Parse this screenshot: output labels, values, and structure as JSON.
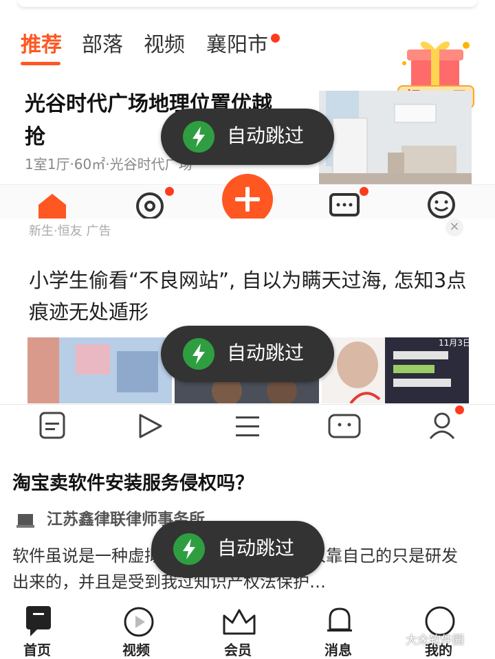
{
  "panel1": {
    "tabs": [
      "推荐",
      "部落",
      "视频",
      "襄阳市"
    ],
    "gift_label": "领380元",
    "listing_title": "光谷时代广场地理位置优越抢",
    "listing_meta": "1室1厅·60㎡·光谷时代广场"
  },
  "panel2": {
    "source": "新生·恒友 广告",
    "close": "×",
    "article_title": "小学生偷看“不良网站”, 自以为瞒天过海, 怎知3点痕迹无处遁形",
    "image_caption": "11月3日"
  },
  "panel3": {
    "question_title": "淘宝卖软件安装服务侵权吗？",
    "author": "江苏鑫律联律师事务所",
    "body": "软件虽说是一种虚拟产品，但也毕竟是他人靠自己的只是研发出来的，并且是受到我过知识产权法保护…",
    "nav": [
      "首页",
      "视频",
      "会员",
      "消息",
      "我的"
    ]
  },
  "toasts": {
    "label": "自动跳过"
  },
  "watermark": "大众软件园",
  "colors": {
    "accent": "#ff5722",
    "notify_dot": "#ff3b1f",
    "toast_bg": "#333333",
    "toast_icon": "#2f9e41"
  },
  "icons": [
    "home-icon",
    "circle-dot-icon",
    "plus-icon",
    "chat-icon",
    "smile-icon",
    "list-icon",
    "play-icon",
    "menu-icon",
    "pet-icon",
    "user-icon",
    "lightning-icon",
    "bell-icon",
    "crown-icon",
    "chat-bubble-icon"
  ]
}
